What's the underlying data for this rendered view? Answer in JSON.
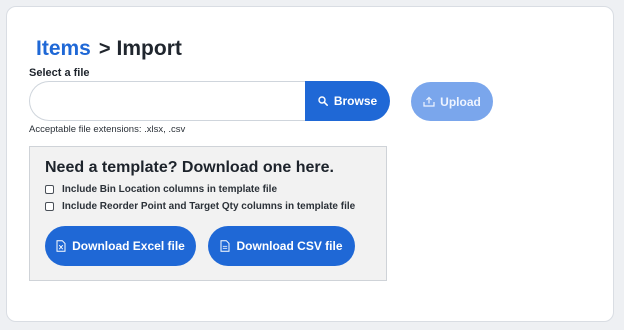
{
  "breadcrumb": {
    "parent": "Items",
    "separator": ">",
    "current": "Import"
  },
  "file_select": {
    "label": "Select a file",
    "value": "",
    "placeholder": "",
    "browse_label": "Browse",
    "upload_label": "Upload",
    "hint": "Acceptable file extensions: .xlsx, .csv"
  },
  "template": {
    "title": "Need a template? Download one here.",
    "options": [
      {
        "label": "Include Bin Location columns in template file",
        "checked": false
      },
      {
        "label": "Include Reorder Point and Target Qty columns in template file",
        "checked": false
      }
    ],
    "download_excel_label": "Download Excel file",
    "download_csv_label": "Download CSV file"
  },
  "icons": {
    "browse": "search-icon",
    "upload": "upload-icon",
    "excel": "excel-file-icon",
    "csv": "csv-file-icon"
  },
  "colors": {
    "accent": "#1f68d6",
    "upload_disabled": "#7aa6ec",
    "panel": "#f2f2f2"
  }
}
